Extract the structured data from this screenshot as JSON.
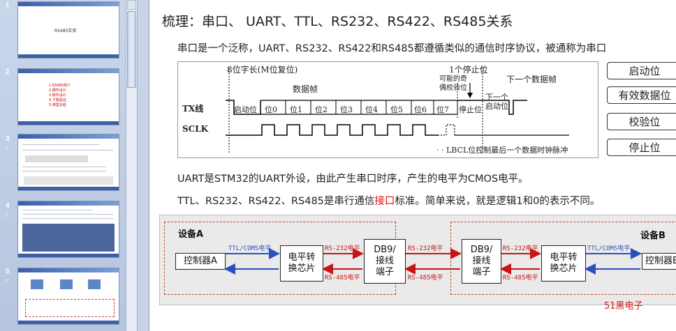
{
  "sidebar": {
    "slides": [
      {
        "number": "1",
        "star": "",
        "title": "RS485实验"
      },
      {
        "number": "2",
        "star": "",
        "items": [
          "1.RS485简介",
          "2.硬件设计",
          "3.软件设计",
          "4.下载验证",
          "5.课堂总结"
        ]
      },
      {
        "number": "3",
        "star": "☆"
      },
      {
        "number": "4",
        "star": "☆"
      },
      {
        "number": "5",
        "star": "☆"
      }
    ]
  },
  "slide": {
    "title": "梳理：串口、 UART、TTL、RS232、RS422、RS485关系",
    "line1": "串口是一个泛称，UART、RS232、RS422和RS485都遵循类似的通信时序协议，被通称为串口",
    "line2": "UART是STM32的UART外设，由此产生串口时序，产生的电平为CMOS电平。",
    "line3_pre": "TTL、RS232、RS422、RS485是串行通信",
    "line3_highlight": "接口",
    "line3_post": "标准。简单来说，就是逻辑1和0的表示不同。",
    "highlight_color": "#e01010",
    "brand": "51黑电子"
  },
  "timing": {
    "word_len": "8位字长(M位复位)",
    "stop_label": "1个停止位",
    "next_frame": "下一个数据帧",
    "data_frame": "数据帧",
    "parity": "可能的奇\n偶校验位",
    "tx": "TX线",
    "sclk": "SCLK",
    "bits": [
      "启动位",
      "位0",
      "位1",
      "位2",
      "位3",
      "位4",
      "位5",
      "位6",
      "位7",
      "停止位"
    ],
    "next_start": "下一个\n启动位",
    "footnote": "· · LBCL位控制最后一个数据时钟脉冲"
  },
  "side_boxes": [
    "启动位",
    "有效数据位",
    "校验位",
    "停止位"
  ],
  "connection": {
    "device_a": "设备A",
    "device_b": "设备B",
    "controller_a": "控制器A",
    "controller_b": "控制器B",
    "level_conv": "电平转\n换芯片",
    "db9": "DB9/\n接线\n端子",
    "ttl_label": "TTL/COMS电平",
    "rs232_label": "RS-232电平",
    "rs485_label": "RS-485电平",
    "blue": "#2a4fbf",
    "red": "#c81414"
  }
}
